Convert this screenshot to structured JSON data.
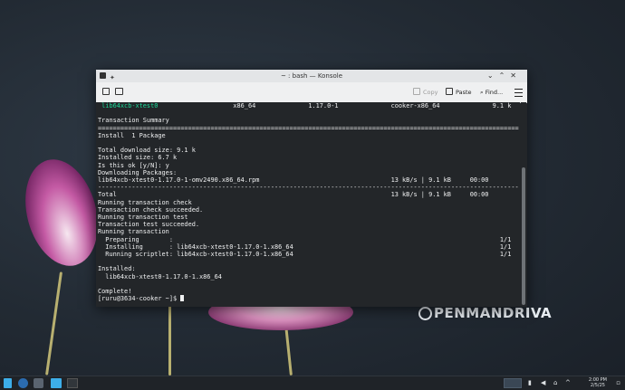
{
  "window": {
    "title": "~ : bash — Konsole",
    "toolbar": {
      "copy_label": "Copy",
      "paste_label": "Paste",
      "find_label": "Find..."
    }
  },
  "terminal": {
    "lines": [
      {
        "name": "lib64xcb-xtest0",
        "arch": "x86_64",
        "version": "1.17.0-1",
        "repo": "cooker-x86_64",
        "size": "9.1 k"
      },
      "",
      "Transaction Summary",
      "================================================================================================================",
      "Install  1 Package",
      "",
      "Total download size: 9.1 k",
      "Installed size: 6.7 k",
      "Is this ok [y/N]: y",
      "Downloading Packages:",
      "lib64xcb-xtest0-1.17.0-1-omv2490.x86_64.rpm                                   13 kB/s | 9.1 kB     00:00",
      "----------------------------------------------------------------------------------------------------------------",
      "Total                                                                         13 kB/s | 9.1 kB     00:00",
      "Running transaction check",
      "Transaction check succeeded.",
      "Running transaction test",
      "Transaction test succeeded.",
      "Running transaction",
      "  Preparing        :                                                                                       1/1",
      "  Installing       : lib64xcb-xtest0-1.17.0-1.x86_64                                                       1/1",
      "  Running scriptlet: lib64xcb-xtest0-1.17.0-1.x86_64                                                       1/1",
      "",
      "Installed:",
      "  lib64xcb-xtest0-1.17.0-1.x86_64",
      "",
      "Complete!"
    ],
    "prompt": "[ruru@3634-cooker ~]$ "
  },
  "wallpaper": {
    "logo_text": "PENMANDRIVA"
  },
  "taskbar": {
    "time": "2:00 PM",
    "date": "2/5/25"
  },
  "colors": {
    "terminal_bg": "#232629",
    "highlight": "#1cdc9a",
    "accent": "#3daee9"
  }
}
